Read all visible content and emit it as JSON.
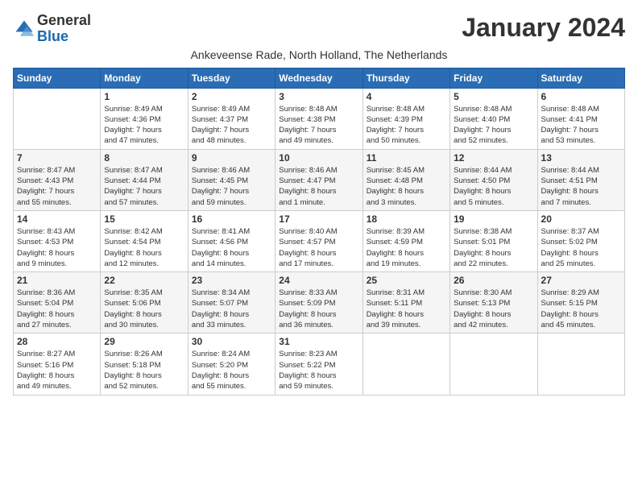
{
  "header": {
    "logo_general": "General",
    "logo_blue": "Blue",
    "month_title": "January 2024",
    "subtitle": "Ankeveense Rade, North Holland, The Netherlands"
  },
  "days_of_week": [
    "Sunday",
    "Monday",
    "Tuesday",
    "Wednesday",
    "Thursday",
    "Friday",
    "Saturday"
  ],
  "weeks": [
    [
      {
        "day": "",
        "info": ""
      },
      {
        "day": "1",
        "info": "Sunrise: 8:49 AM\nSunset: 4:36 PM\nDaylight: 7 hours\nand 47 minutes."
      },
      {
        "day": "2",
        "info": "Sunrise: 8:49 AM\nSunset: 4:37 PM\nDaylight: 7 hours\nand 48 minutes."
      },
      {
        "day": "3",
        "info": "Sunrise: 8:48 AM\nSunset: 4:38 PM\nDaylight: 7 hours\nand 49 minutes."
      },
      {
        "day": "4",
        "info": "Sunrise: 8:48 AM\nSunset: 4:39 PM\nDaylight: 7 hours\nand 50 minutes."
      },
      {
        "day": "5",
        "info": "Sunrise: 8:48 AM\nSunset: 4:40 PM\nDaylight: 7 hours\nand 52 minutes."
      },
      {
        "day": "6",
        "info": "Sunrise: 8:48 AM\nSunset: 4:41 PM\nDaylight: 7 hours\nand 53 minutes."
      }
    ],
    [
      {
        "day": "7",
        "info": "Sunrise: 8:47 AM\nSunset: 4:43 PM\nDaylight: 7 hours\nand 55 minutes."
      },
      {
        "day": "8",
        "info": "Sunrise: 8:47 AM\nSunset: 4:44 PM\nDaylight: 7 hours\nand 57 minutes."
      },
      {
        "day": "9",
        "info": "Sunrise: 8:46 AM\nSunset: 4:45 PM\nDaylight: 7 hours\nand 59 minutes."
      },
      {
        "day": "10",
        "info": "Sunrise: 8:46 AM\nSunset: 4:47 PM\nDaylight: 8 hours\nand 1 minute."
      },
      {
        "day": "11",
        "info": "Sunrise: 8:45 AM\nSunset: 4:48 PM\nDaylight: 8 hours\nand 3 minutes."
      },
      {
        "day": "12",
        "info": "Sunrise: 8:44 AM\nSunset: 4:50 PM\nDaylight: 8 hours\nand 5 minutes."
      },
      {
        "day": "13",
        "info": "Sunrise: 8:44 AM\nSunset: 4:51 PM\nDaylight: 8 hours\nand 7 minutes."
      }
    ],
    [
      {
        "day": "14",
        "info": "Sunrise: 8:43 AM\nSunset: 4:53 PM\nDaylight: 8 hours\nand 9 minutes."
      },
      {
        "day": "15",
        "info": "Sunrise: 8:42 AM\nSunset: 4:54 PM\nDaylight: 8 hours\nand 12 minutes."
      },
      {
        "day": "16",
        "info": "Sunrise: 8:41 AM\nSunset: 4:56 PM\nDaylight: 8 hours\nand 14 minutes."
      },
      {
        "day": "17",
        "info": "Sunrise: 8:40 AM\nSunset: 4:57 PM\nDaylight: 8 hours\nand 17 minutes."
      },
      {
        "day": "18",
        "info": "Sunrise: 8:39 AM\nSunset: 4:59 PM\nDaylight: 8 hours\nand 19 minutes."
      },
      {
        "day": "19",
        "info": "Sunrise: 8:38 AM\nSunset: 5:01 PM\nDaylight: 8 hours\nand 22 minutes."
      },
      {
        "day": "20",
        "info": "Sunrise: 8:37 AM\nSunset: 5:02 PM\nDaylight: 8 hours\nand 25 minutes."
      }
    ],
    [
      {
        "day": "21",
        "info": "Sunrise: 8:36 AM\nSunset: 5:04 PM\nDaylight: 8 hours\nand 27 minutes."
      },
      {
        "day": "22",
        "info": "Sunrise: 8:35 AM\nSunset: 5:06 PM\nDaylight: 8 hours\nand 30 minutes."
      },
      {
        "day": "23",
        "info": "Sunrise: 8:34 AM\nSunset: 5:07 PM\nDaylight: 8 hours\nand 33 minutes."
      },
      {
        "day": "24",
        "info": "Sunrise: 8:33 AM\nSunset: 5:09 PM\nDaylight: 8 hours\nand 36 minutes."
      },
      {
        "day": "25",
        "info": "Sunrise: 8:31 AM\nSunset: 5:11 PM\nDaylight: 8 hours\nand 39 minutes."
      },
      {
        "day": "26",
        "info": "Sunrise: 8:30 AM\nSunset: 5:13 PM\nDaylight: 8 hours\nand 42 minutes."
      },
      {
        "day": "27",
        "info": "Sunrise: 8:29 AM\nSunset: 5:15 PM\nDaylight: 8 hours\nand 45 minutes."
      }
    ],
    [
      {
        "day": "28",
        "info": "Sunrise: 8:27 AM\nSunset: 5:16 PM\nDaylight: 8 hours\nand 49 minutes."
      },
      {
        "day": "29",
        "info": "Sunrise: 8:26 AM\nSunset: 5:18 PM\nDaylight: 8 hours\nand 52 minutes."
      },
      {
        "day": "30",
        "info": "Sunrise: 8:24 AM\nSunset: 5:20 PM\nDaylight: 8 hours\nand 55 minutes."
      },
      {
        "day": "31",
        "info": "Sunrise: 8:23 AM\nSunset: 5:22 PM\nDaylight: 8 hours\nand 59 minutes."
      },
      {
        "day": "",
        "info": ""
      },
      {
        "day": "",
        "info": ""
      },
      {
        "day": "",
        "info": ""
      }
    ]
  ]
}
